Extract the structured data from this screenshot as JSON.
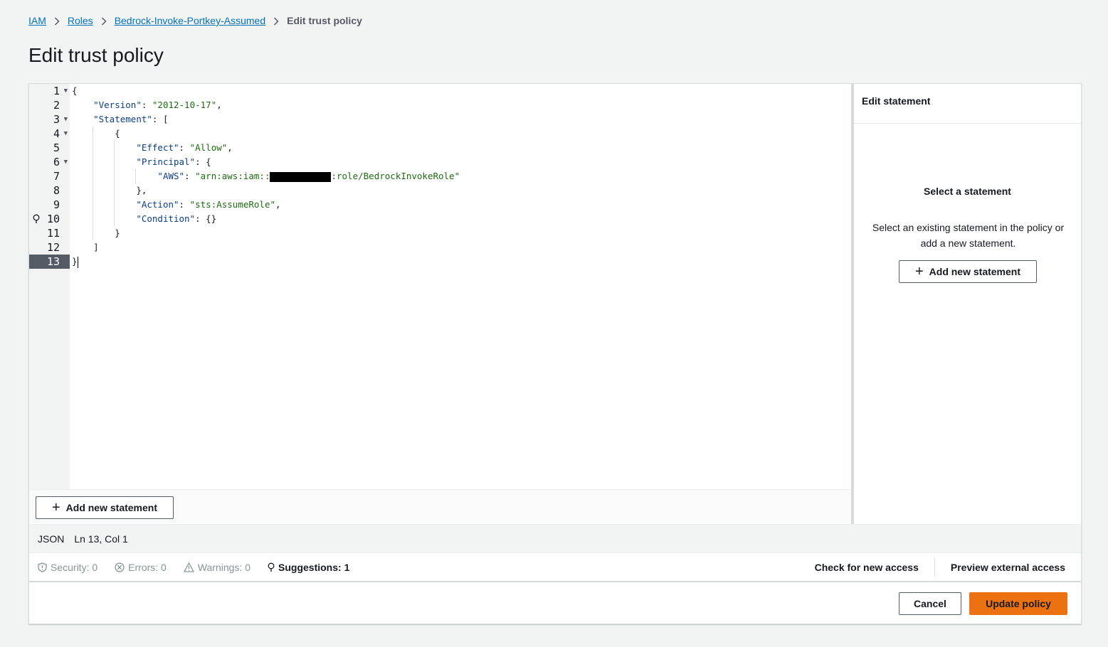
{
  "breadcrumb": {
    "items": [
      "IAM",
      "Roles",
      "Bedrock-Invoke-Portkey-Assumed"
    ],
    "current": "Edit trust policy"
  },
  "page": {
    "title": "Edit trust policy"
  },
  "editor": {
    "line_numbers": [
      "1",
      "2",
      "3",
      "4",
      "5",
      "6",
      "7",
      "8",
      "9",
      "10",
      "11",
      "12",
      "13"
    ],
    "active_line": "13",
    "code": {
      "l1_open": "{",
      "version_key": "\"Version\"",
      "version_val": "\"2012-10-17\"",
      "statement_key": "\"Statement\"",
      "l3_bracket": "[",
      "l4_open": "{",
      "effect_key": "\"Effect\"",
      "effect_val": "\"Allow\"",
      "principal_key": "\"Principal\"",
      "l6_open": "{",
      "aws_key": "\"AWS\"",
      "aws_val_prefix": "\"arn:aws:iam::",
      "aws_val_suffix": ":role/BedrockInvokeRole\"",
      "l8_close": "},",
      "action_key": "\"Action\"",
      "action_val": "\"sts:AssumeRole\"",
      "condition_key": "\"Condition\"",
      "condition_val": "{}",
      "l11_close": "}",
      "l12_close": "]",
      "l13_close": "}"
    },
    "add_statement_label": "Add new statement"
  },
  "side_panel": {
    "header": "Edit statement",
    "title": "Select a statement",
    "description": "Select an existing statement in the policy or add a new statement.",
    "add_statement_label": "Add new statement"
  },
  "status_bar": {
    "language": "JSON",
    "position": "Ln 13, Col 1"
  },
  "validation": {
    "security": "Security: 0",
    "errors": "Errors: 0",
    "warnings": "Warnings: 0",
    "suggestions": "Suggestions: 1",
    "check_new_access": "Check for new access",
    "preview_external": "Preview external access"
  },
  "actions": {
    "cancel": "Cancel",
    "update": "Update policy"
  },
  "colors": {
    "primary_button": "#ec7211",
    "link": "#0073bb",
    "json_key": "#0b3e8a",
    "json_string": "#1d6b10"
  }
}
